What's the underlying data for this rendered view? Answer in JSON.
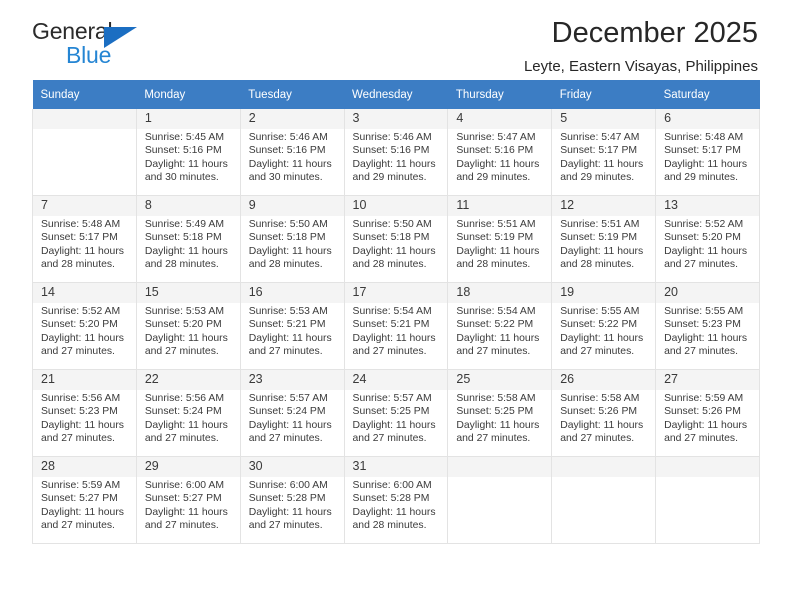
{
  "brand": {
    "name_part1": "General",
    "name_part2": "Blue",
    "accent_color": "#2585d3",
    "triangle_color": "#1b6ec2"
  },
  "header": {
    "title": "December 2025",
    "subtitle": "Leyte, Eastern Visayas, Philippines"
  },
  "calendar": {
    "header_bg": "#3c7dc4",
    "weekday_headers": [
      "Sunday",
      "Monday",
      "Tuesday",
      "Wednesday",
      "Thursday",
      "Friday",
      "Saturday"
    ],
    "weeks": [
      [
        {
          "day": "",
          "detail": ""
        },
        {
          "day": "1",
          "detail": "Sunrise: 5:45 AM\nSunset: 5:16 PM\nDaylight: 11 hours\nand 30 minutes."
        },
        {
          "day": "2",
          "detail": "Sunrise: 5:46 AM\nSunset: 5:16 PM\nDaylight: 11 hours\nand 30 minutes."
        },
        {
          "day": "3",
          "detail": "Sunrise: 5:46 AM\nSunset: 5:16 PM\nDaylight: 11 hours\nand 29 minutes."
        },
        {
          "day": "4",
          "detail": "Sunrise: 5:47 AM\nSunset: 5:16 PM\nDaylight: 11 hours\nand 29 minutes."
        },
        {
          "day": "5",
          "detail": "Sunrise: 5:47 AM\nSunset: 5:17 PM\nDaylight: 11 hours\nand 29 minutes."
        },
        {
          "day": "6",
          "detail": "Sunrise: 5:48 AM\nSunset: 5:17 PM\nDaylight: 11 hours\nand 29 minutes."
        }
      ],
      [
        {
          "day": "7",
          "detail": "Sunrise: 5:48 AM\nSunset: 5:17 PM\nDaylight: 11 hours\nand 28 minutes."
        },
        {
          "day": "8",
          "detail": "Sunrise: 5:49 AM\nSunset: 5:18 PM\nDaylight: 11 hours\nand 28 minutes."
        },
        {
          "day": "9",
          "detail": "Sunrise: 5:50 AM\nSunset: 5:18 PM\nDaylight: 11 hours\nand 28 minutes."
        },
        {
          "day": "10",
          "detail": "Sunrise: 5:50 AM\nSunset: 5:18 PM\nDaylight: 11 hours\nand 28 minutes."
        },
        {
          "day": "11",
          "detail": "Sunrise: 5:51 AM\nSunset: 5:19 PM\nDaylight: 11 hours\nand 28 minutes."
        },
        {
          "day": "12",
          "detail": "Sunrise: 5:51 AM\nSunset: 5:19 PM\nDaylight: 11 hours\nand 28 minutes."
        },
        {
          "day": "13",
          "detail": "Sunrise: 5:52 AM\nSunset: 5:20 PM\nDaylight: 11 hours\nand 27 minutes."
        }
      ],
      [
        {
          "day": "14",
          "detail": "Sunrise: 5:52 AM\nSunset: 5:20 PM\nDaylight: 11 hours\nand 27 minutes."
        },
        {
          "day": "15",
          "detail": "Sunrise: 5:53 AM\nSunset: 5:20 PM\nDaylight: 11 hours\nand 27 minutes."
        },
        {
          "day": "16",
          "detail": "Sunrise: 5:53 AM\nSunset: 5:21 PM\nDaylight: 11 hours\nand 27 minutes."
        },
        {
          "day": "17",
          "detail": "Sunrise: 5:54 AM\nSunset: 5:21 PM\nDaylight: 11 hours\nand 27 minutes."
        },
        {
          "day": "18",
          "detail": "Sunrise: 5:54 AM\nSunset: 5:22 PM\nDaylight: 11 hours\nand 27 minutes."
        },
        {
          "day": "19",
          "detail": "Sunrise: 5:55 AM\nSunset: 5:22 PM\nDaylight: 11 hours\nand 27 minutes."
        },
        {
          "day": "20",
          "detail": "Sunrise: 5:55 AM\nSunset: 5:23 PM\nDaylight: 11 hours\nand 27 minutes."
        }
      ],
      [
        {
          "day": "21",
          "detail": "Sunrise: 5:56 AM\nSunset: 5:23 PM\nDaylight: 11 hours\nand 27 minutes."
        },
        {
          "day": "22",
          "detail": "Sunrise: 5:56 AM\nSunset: 5:24 PM\nDaylight: 11 hours\nand 27 minutes."
        },
        {
          "day": "23",
          "detail": "Sunrise: 5:57 AM\nSunset: 5:24 PM\nDaylight: 11 hours\nand 27 minutes."
        },
        {
          "day": "24",
          "detail": "Sunrise: 5:57 AM\nSunset: 5:25 PM\nDaylight: 11 hours\nand 27 minutes."
        },
        {
          "day": "25",
          "detail": "Sunrise: 5:58 AM\nSunset: 5:25 PM\nDaylight: 11 hours\nand 27 minutes."
        },
        {
          "day": "26",
          "detail": "Sunrise: 5:58 AM\nSunset: 5:26 PM\nDaylight: 11 hours\nand 27 minutes."
        },
        {
          "day": "27",
          "detail": "Sunrise: 5:59 AM\nSunset: 5:26 PM\nDaylight: 11 hours\nand 27 minutes."
        }
      ],
      [
        {
          "day": "28",
          "detail": "Sunrise: 5:59 AM\nSunset: 5:27 PM\nDaylight: 11 hours\nand 27 minutes."
        },
        {
          "day": "29",
          "detail": "Sunrise: 6:00 AM\nSunset: 5:27 PM\nDaylight: 11 hours\nand 27 minutes."
        },
        {
          "day": "30",
          "detail": "Sunrise: 6:00 AM\nSunset: 5:28 PM\nDaylight: 11 hours\nand 27 minutes."
        },
        {
          "day": "31",
          "detail": "Sunrise: 6:00 AM\nSunset: 5:28 PM\nDaylight: 11 hours\nand 28 minutes."
        },
        {
          "day": "",
          "detail": ""
        },
        {
          "day": "",
          "detail": ""
        },
        {
          "day": "",
          "detail": ""
        }
      ]
    ]
  }
}
